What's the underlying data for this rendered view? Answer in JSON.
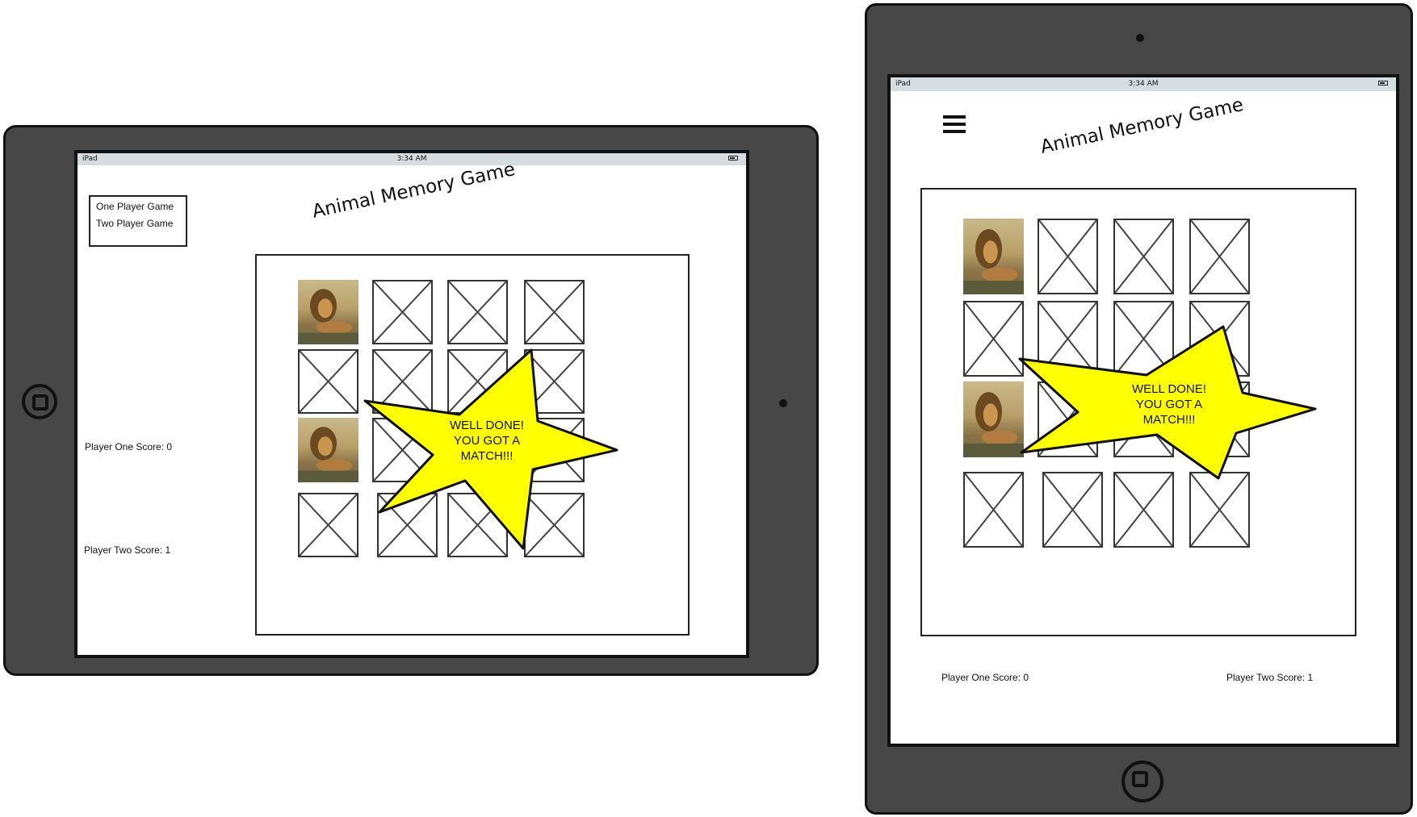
{
  "app_title": "Animal Memory Game",
  "status_bar": {
    "carrier": "iPad",
    "time": "3:34 AM"
  },
  "game_mode_menu": {
    "one_player": "One Player Game",
    "two_player": "Two Player Game"
  },
  "scores": {
    "player_one": "Player One Score: 0",
    "player_two": "Player Two Score: 1"
  },
  "match_message": "WELL DONE! YOU GOT A MATCH!!!",
  "colors": {
    "device_frame": "#474747",
    "status_bar": "#d6dde1",
    "star_fill": "#ffff00"
  },
  "icons": {
    "hamburger": "hamburger-icon",
    "home": "home-button-icon",
    "placeholder": "image-placeholder-icon"
  },
  "landscape_cards": [
    "lion",
    "hidden",
    "hidden",
    "hidden",
    "hidden",
    "hidden",
    "hidden",
    "hidden",
    "lion",
    "hidden",
    "hidden",
    "hidden",
    "hidden",
    "hidden",
    "hidden",
    "hidden"
  ],
  "portrait_cards": [
    "lion",
    "hidden",
    "hidden",
    "hidden",
    "hidden",
    "hidden",
    "hidden",
    "hidden",
    "lion",
    "hidden",
    "hidden",
    "hidden",
    "hidden",
    "hidden",
    "hidden",
    "hidden"
  ]
}
